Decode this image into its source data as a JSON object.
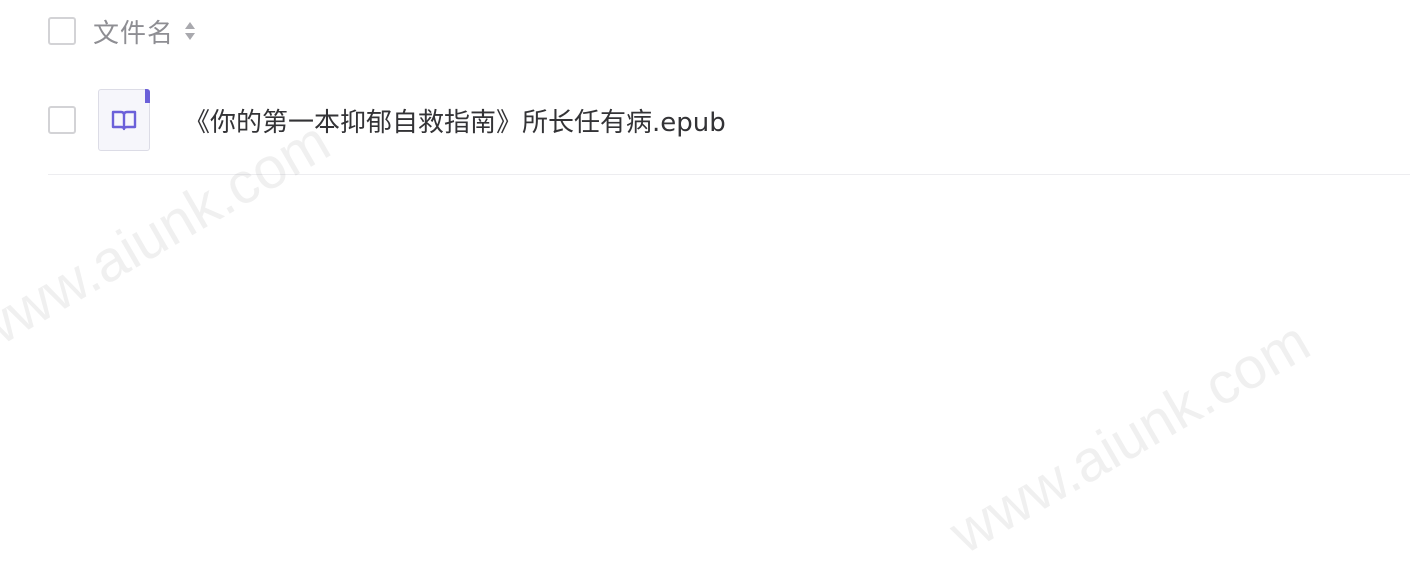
{
  "table": {
    "header": {
      "column_title": "文件名",
      "sort_icon": "sort-updown-icon"
    },
    "rows": [
      {
        "icon": "book-icon",
        "filename": "《你的第一本抑郁自救指南》所长任有病.epub"
      }
    ]
  },
  "watermark": "www.aiunk.com",
  "colors": {
    "accent": "#6b60d9",
    "header_text": "#8e8e93",
    "body_text": "#333336",
    "checkbox_border": "#d3d3d6",
    "divider": "#ededf0"
  }
}
